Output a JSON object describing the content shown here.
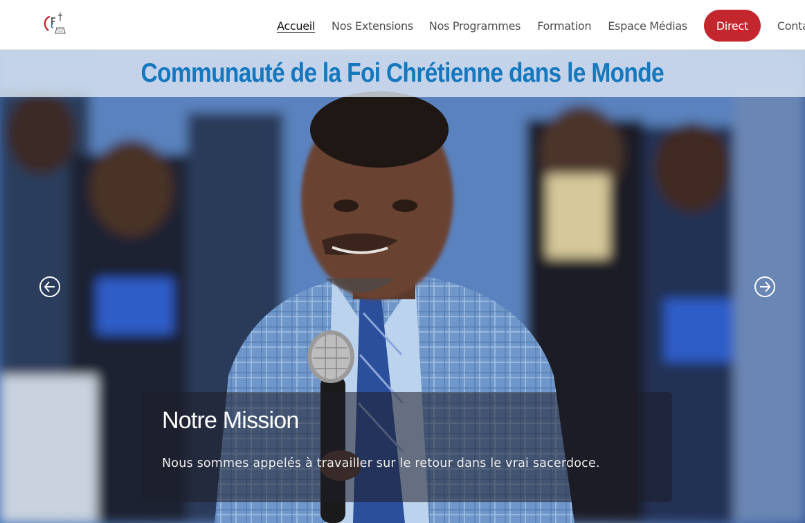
{
  "colors": {
    "accent_red": "#c4262e",
    "title_blue": "#1577bd",
    "nav_text": "#4d4d4d",
    "active_text": "#111111"
  },
  "header": {
    "logo_icon": "church-logo-icon",
    "nav": {
      "accueil": "Accueil",
      "extensions": "Nos Extensions",
      "programmes": "Nos Programmes",
      "formation": "Formation",
      "medias": "Espace Médias",
      "direct": "Direct",
      "contact": "Contact"
    },
    "active_item": "Accueil"
  },
  "hero": {
    "title": "Communauté de la Foi Chrétienne dans le Monde",
    "prev_icon": "arrow-left-circle-icon",
    "next_icon": "arrow-right-circle-icon",
    "slide": {
      "heading": "Notre Mission",
      "text": "Nous sommes appelés à travailler sur le retour dans le vrai sacerdoce."
    }
  }
}
